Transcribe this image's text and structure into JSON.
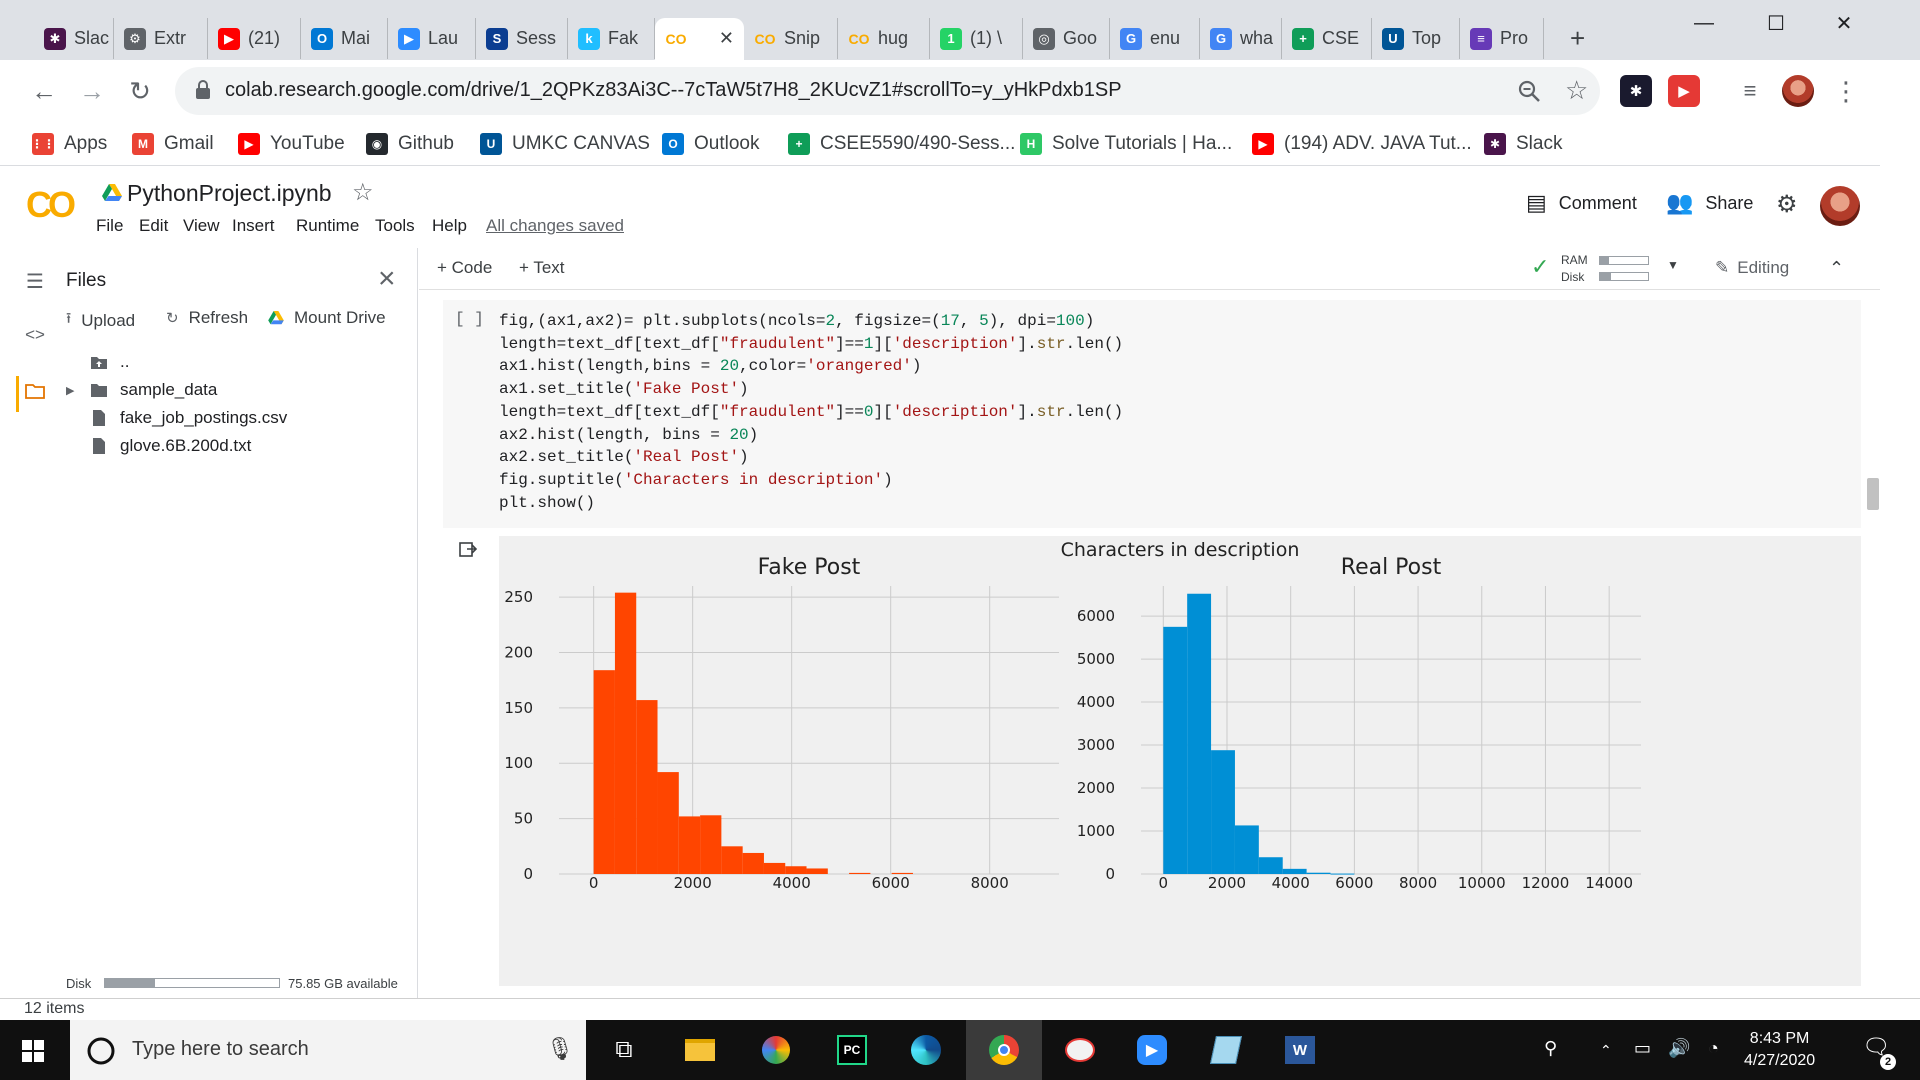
{
  "browser": {
    "tabs": [
      {
        "label": "Slac",
        "icon": "slack-icon",
        "color": "#4a154b"
      },
      {
        "label": "Extr",
        "icon": "extension-icon",
        "color": "#5f6368"
      },
      {
        "label": "(21)",
        "icon": "youtube-icon",
        "color": "#ff0000"
      },
      {
        "label": "Mai",
        "icon": "outlook-icon",
        "color": "#0078d4"
      },
      {
        "label": "Lau",
        "icon": "zoom-icon",
        "color": "#2d8cff"
      },
      {
        "label": "Sess",
        "icon": "session-icon",
        "color": "#0b3d91"
      },
      {
        "label": "Fak",
        "icon": "kaggle-icon",
        "color": "#20beff"
      },
      {
        "label": "",
        "icon": "colab-icon",
        "color": "#f9ab00",
        "active": true
      },
      {
        "label": "Snip",
        "icon": "colab-icon",
        "color": "#f9ab00"
      },
      {
        "label": "hug",
        "icon": "colab-icon",
        "color": "#f9ab00"
      },
      {
        "label": "(1) \\",
        "icon": "whatsapp-icon",
        "color": "#25d366"
      },
      {
        "label": "Goo",
        "icon": "globe-icon",
        "color": "#5f6368"
      },
      {
        "label": "enu",
        "icon": "google-icon",
        "color": "#4285f4"
      },
      {
        "label": "wha",
        "icon": "google-icon",
        "color": "#4285f4"
      },
      {
        "label": "CSE",
        "icon": "sheets-plus-icon",
        "color": "#0f9d58"
      },
      {
        "label": "Top",
        "icon": "umkc-icon",
        "color": "#005596"
      },
      {
        "label": "Pro",
        "icon": "forms-icon",
        "color": "#673ab7"
      }
    ],
    "active_tab_close": "✕",
    "new_tab": "+",
    "url": "colab.research.google.com/drive/1_2QPKz83Ai3C--7cTaW5t7H8_2KUcvZ1#scrollTo=y_yHkPdxb1SP",
    "bookmarks": [
      {
        "label": "Apps",
        "icon": "apps-grid-icon",
        "color": "#ea4335"
      },
      {
        "label": "Gmail",
        "icon": "gmail-icon",
        "color": "#ea4335"
      },
      {
        "label": "YouTube",
        "icon": "youtube-icon",
        "color": "#ff0000"
      },
      {
        "label": "Github",
        "icon": "github-icon",
        "color": "#24292e"
      },
      {
        "label": "UMKC CANVAS",
        "icon": "umkc-icon",
        "color": "#005596"
      },
      {
        "label": "Outlook",
        "icon": "outlook-icon",
        "color": "#0078d4"
      },
      {
        "label": "CSEE5590/490-Sess...",
        "icon": "sheets-plus-icon",
        "color": "#0f9d58"
      },
      {
        "label": "Solve Tutorials | Ha...",
        "icon": "hackerrank-icon",
        "color": "#2ec866"
      },
      {
        "label": "(194) ADV. JAVA Tut...",
        "icon": "youtube-icon",
        "color": "#ff0000"
      },
      {
        "label": "Slack",
        "icon": "slack-icon",
        "color": "#4a154b"
      }
    ]
  },
  "colab": {
    "logo": "CO",
    "title": "PythonProject.ipynb",
    "menu": [
      "File",
      "Edit",
      "View",
      "Insert",
      "Runtime",
      "Tools",
      "Help"
    ],
    "saved": "All changes saved",
    "comment": "Comment",
    "share": "Share",
    "toolbar": {
      "code": "+ Code",
      "text": "+ Text",
      "ram": "RAM",
      "disk": "Disk",
      "editing": "Editing"
    },
    "ram_level": 0.18,
    "disk_level": 0.22
  },
  "sidebar": {
    "title": "Files",
    "actions": [
      "Upload",
      "Refresh",
      "Mount Drive"
    ],
    "tree": [
      {
        "label": "..",
        "type": "parent"
      },
      {
        "label": "sample_data",
        "type": "folder"
      },
      {
        "label": "fake_job_postings.csv",
        "type": "file"
      },
      {
        "label": "glove.6B.200d.txt",
        "type": "file"
      }
    ],
    "disk_label": "Disk",
    "disk_used_fraction": 0.29,
    "disk_available": "75.85 GB available"
  },
  "cell": {
    "exec_count": "[ ]"
  },
  "chart_data": {
    "suptitle": "Characters in description",
    "charts": [
      {
        "type": "bar",
        "title": "Fake Post",
        "color": "#ff4500",
        "xlim": [
          -700,
          9400
        ],
        "ylim": [
          0,
          260
        ],
        "xticks": [
          0,
          2000,
          4000,
          6000,
          8000
        ],
        "yticks": [
          0,
          50,
          100,
          150,
          200,
          250
        ],
        "bin_width": 430,
        "bins": [
          {
            "x": 0,
            "value": 184
          },
          {
            "x": 430,
            "value": 254
          },
          {
            "x": 860,
            "value": 157
          },
          {
            "x": 1290,
            "value": 92
          },
          {
            "x": 1720,
            "value": 52
          },
          {
            "x": 2150,
            "value": 53
          },
          {
            "x": 2580,
            "value": 25
          },
          {
            "x": 3010,
            "value": 19
          },
          {
            "x": 3440,
            "value": 10
          },
          {
            "x": 3870,
            "value": 7
          },
          {
            "x": 4300,
            "value": 5
          },
          {
            "x": 5160,
            "value": 1
          },
          {
            "x": 6020,
            "value": 1
          }
        ]
      },
      {
        "type": "bar",
        "title": "Real Post",
        "color": "#008fd5",
        "xlim": [
          -700,
          15000
        ],
        "ylim": [
          0,
          6700
        ],
        "xticks": [
          0,
          2000,
          4000,
          6000,
          8000,
          10000,
          12000,
          14000
        ],
        "yticks": [
          0,
          1000,
          2000,
          3000,
          4000,
          5000,
          6000
        ],
        "bin_width": 750,
        "bins": [
          {
            "x": 0,
            "value": 5750
          },
          {
            "x": 750,
            "value": 6520
          },
          {
            "x": 1500,
            "value": 2880
          },
          {
            "x": 2250,
            "value": 1130
          },
          {
            "x": 3000,
            "value": 390
          },
          {
            "x": 3750,
            "value": 120
          },
          {
            "x": 4500,
            "value": 30
          },
          {
            "x": 5250,
            "value": 10
          }
        ]
      }
    ]
  },
  "windows": {
    "items_count": "12 items",
    "search_placeholder": "Type here to search",
    "time": "8:43 PM",
    "date": "4/27/2020",
    "notifications": "2"
  }
}
